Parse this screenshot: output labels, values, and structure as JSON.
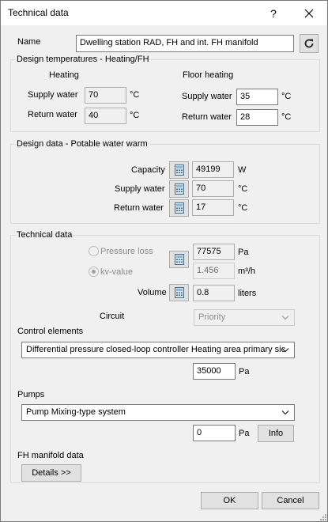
{
  "window": {
    "title": "Technical data",
    "help": "?",
    "close": "✕"
  },
  "name": {
    "label": "Name",
    "value": "Dwelling station RAD, FH and int. FH manifold"
  },
  "design_temps": {
    "title": "Design temperatures - Heating/FH",
    "heating": {
      "title": "Heating",
      "supply_label": "Supply water",
      "supply_value": "70",
      "supply_unit": "°C",
      "return_label": "Return water",
      "return_value": "40",
      "return_unit": "°C"
    },
    "floor": {
      "title": "Floor heating",
      "supply_label": "Supply water",
      "supply_value": "35",
      "supply_unit": "°C",
      "return_label": "Return water",
      "return_value": "28",
      "return_unit": "°C"
    }
  },
  "potable": {
    "title": "Design data - Potable water warm",
    "capacity_label": "Capacity",
    "capacity_value": "49199",
    "capacity_unit": "W",
    "supply_label": "Supply water",
    "supply_value": "70",
    "supply_unit": "°C",
    "return_label": "Return water",
    "return_value": "17",
    "return_unit": "°C"
  },
  "technical": {
    "title": "Technical data",
    "pressure_loss_label": "Pressure loss",
    "pressure_loss_value": "77575",
    "pressure_loss_unit": "Pa",
    "kv_label": "kv-value",
    "kv_value": "1.456",
    "kv_unit": "m³/h",
    "volume_label": "Volume",
    "volume_value": "0.8",
    "volume_unit": "liters",
    "circuit_label": "Circuit",
    "circuit_value": "Priority",
    "control_label": "Control elements",
    "control_value": "Differential pressure closed-loop controller Heating area primary sic",
    "control_pa_value": "35000",
    "control_pa_unit": "Pa",
    "pumps_label": "Pumps",
    "pumps_value": "Pump Mixing-type system",
    "pumps_pa_value": "0",
    "pumps_pa_unit": "Pa",
    "info_label": "Info",
    "fh_label": "FH manifold data",
    "details_label": "Details >>"
  },
  "footer": {
    "ok": "OK",
    "cancel": "Cancel"
  },
  "icons": {
    "refresh": "refresh-icon",
    "calculator": "calculator-icon",
    "chevron": "chevron-down-icon"
  }
}
